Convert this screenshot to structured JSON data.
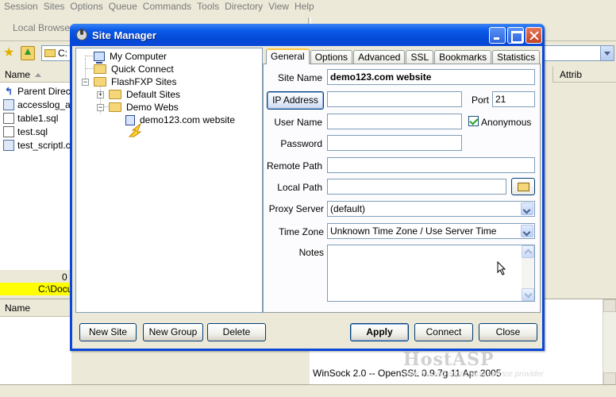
{
  "app": {
    "menu": [
      "Session",
      "Sites",
      "Options",
      "Queue",
      "Commands",
      "Tools",
      "Directory",
      "View",
      "Help"
    ],
    "local_browser_label": "Local Browser",
    "path_value": "C:",
    "file_column_header": "Name",
    "right_column_header": "Attrib",
    "files": [
      {
        "name": "Parent Directo",
        "icon": "parent-dir-icon"
      },
      {
        "name": "accesslog_ab",
        "icon": "database-file-icon"
      },
      {
        "name": "table1.sql",
        "icon": "document-icon"
      },
      {
        "name": "test.sql",
        "icon": "document-icon"
      },
      {
        "name": "test_scriptl.cg",
        "icon": "database-file-icon"
      }
    ],
    "status_count": "0",
    "status_path": "C:\\Docu",
    "bottom_column_header": "Name",
    "log_line": "WinSock 2.0 -- OpenSSL 0.9.7g 11 Apr 2005",
    "watermark": "HostASP",
    "watermark_tagline": "your trusted application service provider"
  },
  "dialog": {
    "title": "Site Manager",
    "tree": [
      {
        "label": "My Computer",
        "icon": "computer-icon"
      },
      {
        "label": "Quick Connect",
        "icon": "folder-icon"
      },
      {
        "label": "FlashFXP Sites",
        "icon": "folder-open-icon"
      },
      {
        "label": "Default Sites",
        "icon": "folder-icon"
      },
      {
        "label": "Demo Webs",
        "icon": "folder-open-icon"
      },
      {
        "label": "demo123.com website",
        "icon": "site-icon"
      }
    ],
    "tabs": [
      "General",
      "Options",
      "Advanced",
      "SSL",
      "Bookmarks",
      "Statistics"
    ],
    "active_tab": "General",
    "general": {
      "site_name_label": "Site Name",
      "site_name_value": "demo123.com website",
      "ip_address_button": "IP Address",
      "ip_address_value": "",
      "port_label": "Port",
      "port_value": "21",
      "user_name_label": "User Name",
      "user_name_value": "",
      "anonymous_label": "Anonymous",
      "anonymous_checked": true,
      "password_label": "Password",
      "password_value": "",
      "remote_path_label": "Remote Path",
      "remote_path_value": "",
      "local_path_label": "Local Path",
      "local_path_value": "",
      "proxy_server_label": "Proxy Server",
      "proxy_server_value": "(default)",
      "time_zone_label": "Time Zone",
      "time_zone_value": "Unknown Time Zone / Use Server Time",
      "notes_label": "Notes",
      "notes_value": ""
    },
    "buttons": {
      "new_site": "New Site",
      "new_group": "New Group",
      "delete": "Delete",
      "apply": "Apply",
      "connect": "Connect",
      "close": "Close"
    }
  }
}
